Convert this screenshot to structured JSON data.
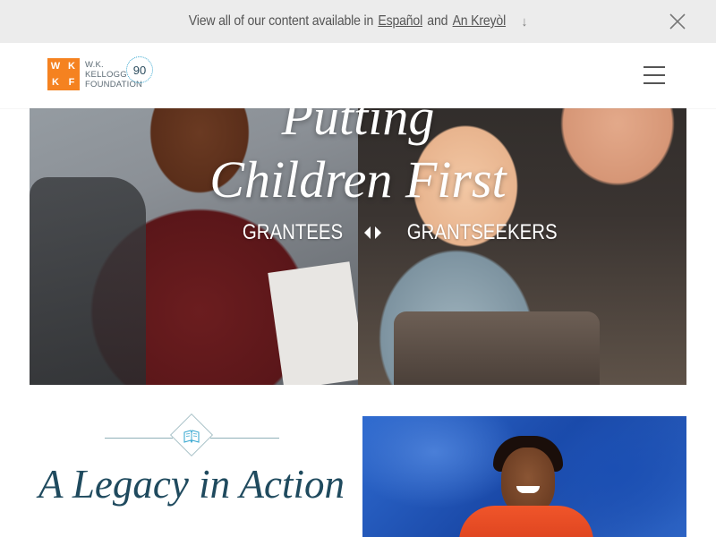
{
  "language_banner": {
    "prefix": "View all of our content available in",
    "link_spanish": "Español",
    "conjunction": "and",
    "link_creole": "An Kreyòl",
    "arrow": "↓"
  },
  "header": {
    "logo": {
      "box_letters": [
        "W",
        "K",
        "K",
        "F"
      ],
      "line1": "W.K.",
      "line2": "KELLOGG",
      "line3": "FOUNDATION",
      "anniversary": "90"
    }
  },
  "hero": {
    "title_line1": "Putting",
    "title_line2": "Children First",
    "link_grantees": "GRANTEES",
    "link_grantseekers": "GRANTSEEKERS"
  },
  "legacy": {
    "title": "A Legacy in Action",
    "icon": "open-book-icon"
  },
  "colors": {
    "brand_orange": "#f58220",
    "accent_blue": "#3ba9d1",
    "title_teal": "#1f4a5e"
  }
}
